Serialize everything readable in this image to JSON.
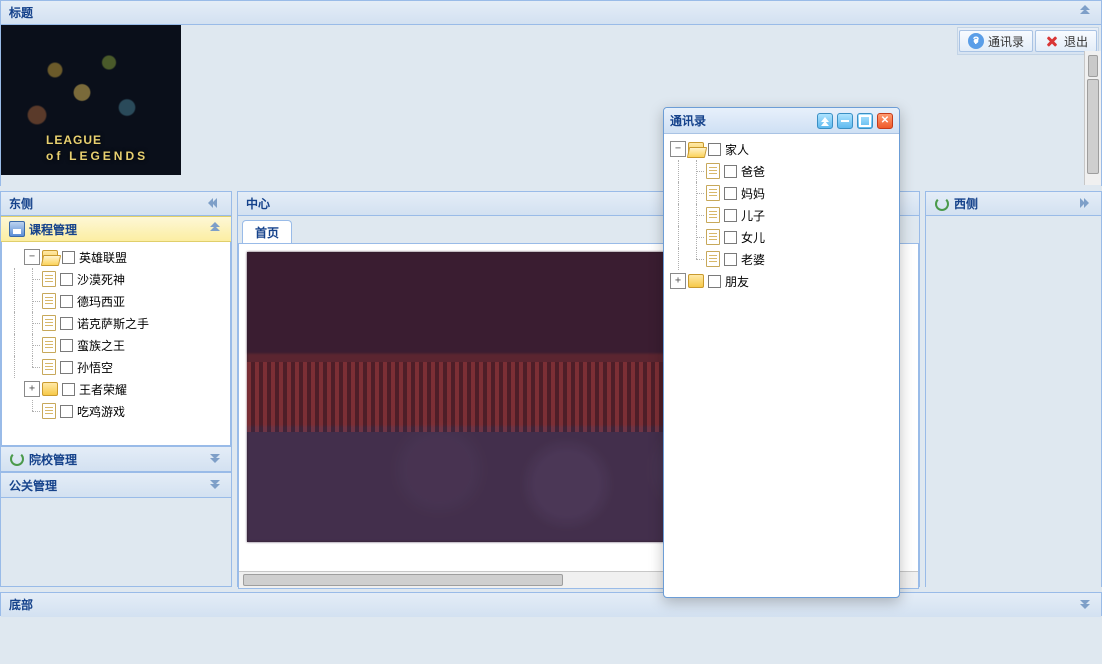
{
  "top": {
    "title": "标题",
    "banner_line1": "LEAGUE",
    "banner_line2": "LEGENDS",
    "banner_of": "of"
  },
  "toolbar": {
    "contacts": "通讯录",
    "exit": "退出"
  },
  "west": {
    "title": "东侧",
    "accordion": [
      {
        "key": "course",
        "label": "课程管理",
        "icon": "disk",
        "expanded": true
      },
      {
        "key": "school",
        "label": "院校管理",
        "icon": "refresh",
        "expanded": false
      },
      {
        "key": "pr",
        "label": "公关管理",
        "icon": "",
        "expanded": false
      }
    ],
    "tree": {
      "nodes": [
        {
          "label": "英雄联盟",
          "type": "folder",
          "expanded": true,
          "children": [
            {
              "label": "沙漠死神",
              "type": "leaf"
            },
            {
              "label": "德玛西亚",
              "type": "leaf"
            },
            {
              "label": "诺克萨斯之手",
              "type": "leaf"
            },
            {
              "label": "蛮族之王",
              "type": "leaf"
            },
            {
              "label": "孙悟空",
              "type": "leaf"
            }
          ]
        },
        {
          "label": "王者荣耀",
          "type": "folder",
          "expanded": false
        },
        {
          "label": "吃鸡游戏",
          "type": "leaf"
        }
      ]
    }
  },
  "center": {
    "title": "中心",
    "tabs": [
      {
        "label": "首页",
        "active": true
      }
    ]
  },
  "east": {
    "title": "西侧"
  },
  "bottom": {
    "title": "底部"
  },
  "contacts_window": {
    "title": "通讯录",
    "tree": {
      "nodes": [
        {
          "label": "家人",
          "type": "folder",
          "expanded": true,
          "children": [
            {
              "label": "爸爸",
              "type": "leaf"
            },
            {
              "label": "妈妈",
              "type": "leaf"
            },
            {
              "label": "儿子",
              "type": "leaf"
            },
            {
              "label": "女儿",
              "type": "leaf"
            },
            {
              "label": "老婆",
              "type": "leaf"
            }
          ]
        },
        {
          "label": "朋友",
          "type": "folder",
          "expanded": false
        }
      ]
    }
  }
}
